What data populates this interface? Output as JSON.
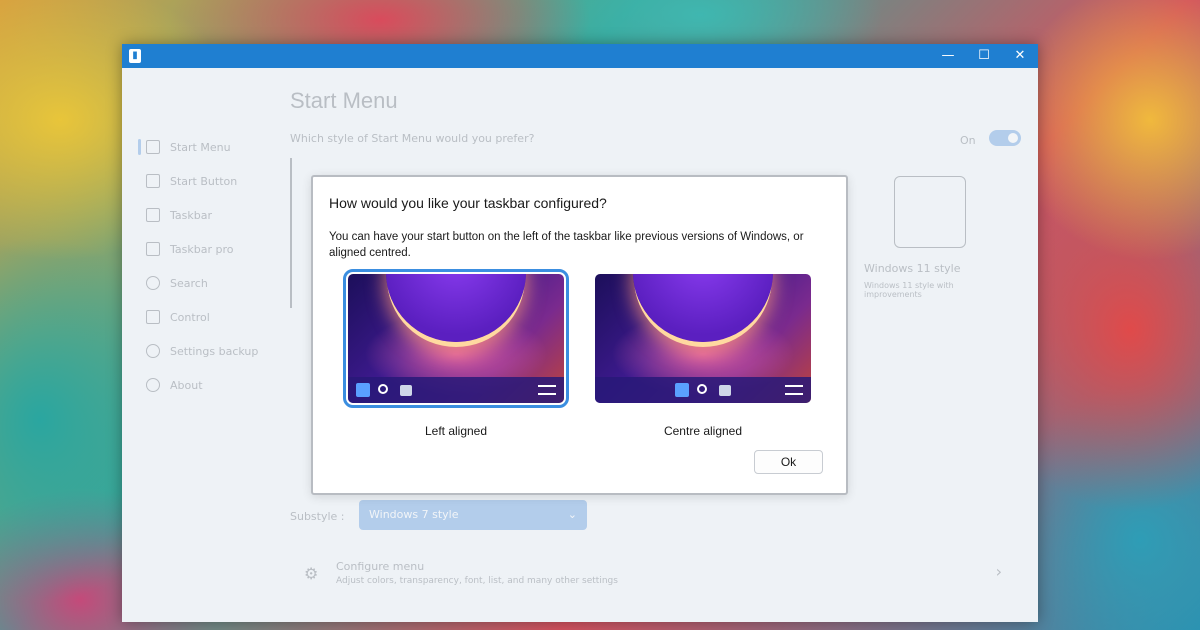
{
  "window": {
    "minimize_glyph": "—",
    "maximize_glyph": "☐",
    "close_glyph": "✕"
  },
  "sidebar": {
    "items": [
      {
        "label": "Start Menu",
        "icon": "start-menu-icon"
      },
      {
        "label": "Start Button",
        "icon": "start-button-icon"
      },
      {
        "label": "Taskbar",
        "icon": "taskbar-icon"
      },
      {
        "label": "Taskbar pro",
        "icon": "taskbar-pro-icon"
      },
      {
        "label": "Search",
        "icon": "search-icon"
      },
      {
        "label": "Control",
        "icon": "control-icon"
      },
      {
        "label": "Settings backup",
        "icon": "backup-icon"
      },
      {
        "label": "About",
        "icon": "info-icon"
      }
    ]
  },
  "main": {
    "title": "Start Menu",
    "question": "Which style of Start Menu would you prefer?",
    "toggle_label": "On",
    "win11_title": "Windows 11 style",
    "win11_desc": "Windows 11 style with improvements",
    "substyle_label": "Substyle :",
    "substyle_value": "Windows 7 style",
    "configure_title": "Configure menu",
    "configure_desc": "Adjust colors, transparency, font, list, and many other settings"
  },
  "dialog": {
    "title": "How would you like your taskbar configured?",
    "description": "You can have your start button on the left of the taskbar like previous versions of Windows, or aligned centred.",
    "options": [
      {
        "label": "Left aligned",
        "selected": true
      },
      {
        "label": "Centre aligned",
        "selected": false
      }
    ],
    "ok_label": "Ok"
  },
  "colors": {
    "titlebar": "#1f7fd1",
    "accent": "#1f6fcf",
    "selection_outline": "#3b8ee0"
  }
}
